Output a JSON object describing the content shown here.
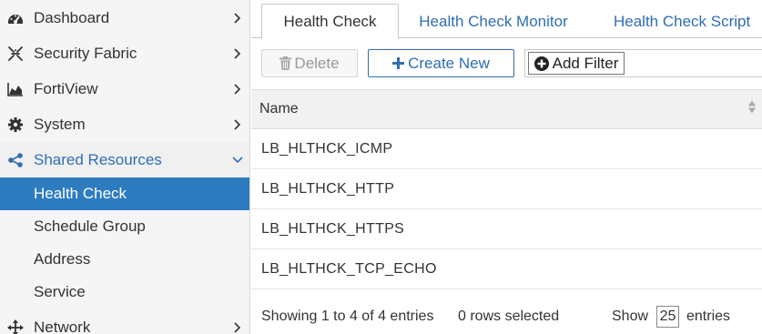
{
  "sidebar": {
    "items": [
      {
        "label": "Dashboard",
        "icon": "dashboard-icon"
      },
      {
        "label": "Security Fabric",
        "icon": "security-fabric-icon"
      },
      {
        "label": "FortiView",
        "icon": "fortiview-icon"
      },
      {
        "label": "System",
        "icon": "gear-icon"
      },
      {
        "label": "Shared Resources",
        "icon": "share-icon",
        "expanded": true
      },
      {
        "label": "Network",
        "icon": "network-move-icon"
      }
    ],
    "subitems": [
      {
        "label": "Health Check",
        "active": true
      },
      {
        "label": "Schedule Group"
      },
      {
        "label": "Address"
      },
      {
        "label": "Service"
      }
    ]
  },
  "tabs": [
    {
      "label": "Health Check",
      "active": true
    },
    {
      "label": "Health Check Monitor"
    },
    {
      "label": "Health Check Script"
    }
  ],
  "toolbar": {
    "delete_label": "Delete",
    "create_label": "Create New",
    "filter_label": "Add Filter"
  },
  "table": {
    "columns": [
      "Name"
    ],
    "rows": [
      "LB_HLTHCK_ICMP",
      "LB_HLTHCK_HTTP",
      "LB_HLTHCK_HTTPS",
      "LB_HLTHCK_TCP_ECHO"
    ]
  },
  "footer": {
    "showing": "Showing 1 to 4 of 4 entries",
    "selected": "0 rows selected",
    "show_label": "Show",
    "page_size": "25",
    "entries_label": "entries"
  },
  "colors": {
    "accent": "#2f6eb4",
    "active_bg": "#2d7cc0",
    "sidebar_bg": "#f5f5f5"
  }
}
